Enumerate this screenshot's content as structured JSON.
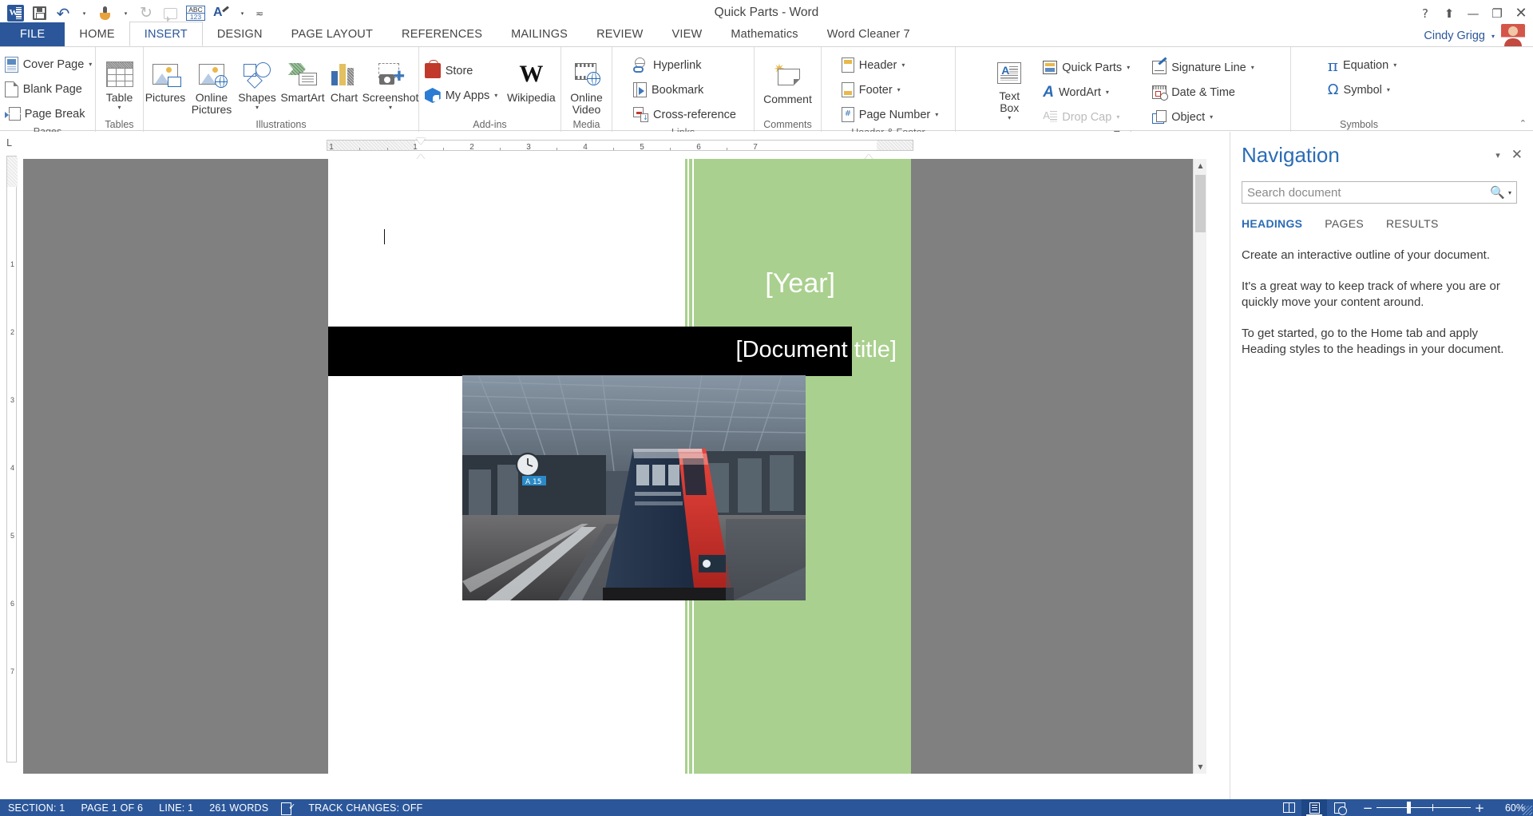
{
  "titlebar": {
    "document_title": "Quick Parts - Word",
    "qat": [
      {
        "name": "word-logo-icon",
        "label": "W"
      },
      {
        "name": "save-icon",
        "label": "Save"
      },
      {
        "name": "undo-icon",
        "label": "Undo"
      },
      {
        "name": "touch-mode-icon",
        "label": "Touch/Mouse Mode"
      },
      {
        "name": "redo-icon",
        "label": "Repeat"
      },
      {
        "name": "comment-balloon-icon",
        "label": "Comment"
      },
      {
        "name": "abc123-icon",
        "label": "ABC 123"
      },
      {
        "name": "style-painter-icon",
        "label": "Styles"
      },
      {
        "name": "customize-qat-icon",
        "label": "Customize"
      }
    ],
    "help_icon": "?",
    "ribbon_display_icon": "⬆",
    "minimize_icon": "—",
    "restore_icon": "❐",
    "close_icon": "✕"
  },
  "tabs": [
    {
      "label": "FILE",
      "active": false,
      "file": true
    },
    {
      "label": "HOME",
      "active": false
    },
    {
      "label": "INSERT",
      "active": true
    },
    {
      "label": "DESIGN",
      "active": false
    },
    {
      "label": "PAGE LAYOUT",
      "active": false
    },
    {
      "label": "REFERENCES",
      "active": false
    },
    {
      "label": "MAILINGS",
      "active": false
    },
    {
      "label": "REVIEW",
      "active": false
    },
    {
      "label": "VIEW",
      "active": false
    },
    {
      "label": "Mathematics",
      "active": false
    },
    {
      "label": "Word Cleaner 7",
      "active": false
    }
  ],
  "user": {
    "name": "Cindy Grigg",
    "caret": "▾"
  },
  "ribbon": {
    "collapse_icon": "⌃",
    "groups": {
      "pages": {
        "label": "Pages",
        "items": [
          {
            "label": "Cover Page",
            "icon": "cover-page-icon",
            "dropdown": "▾"
          },
          {
            "label": "Blank Page",
            "icon": "blank-page-icon",
            "dropdown": ""
          },
          {
            "label": "Page Break",
            "icon": "page-break-icon",
            "dropdown": ""
          }
        ]
      },
      "tables": {
        "label": "Tables",
        "button": {
          "label": "Table",
          "icon": "table-icon",
          "caret": "▾"
        }
      },
      "illustrations": {
        "label": "Illustrations",
        "buttons": [
          {
            "label": "Pictures",
            "icon": "pictures-icon",
            "caret": ""
          },
          {
            "label": "Online\nPictures",
            "icon": "online-pictures-icon",
            "caret": ""
          },
          {
            "label": "Shapes",
            "icon": "shapes-icon",
            "caret": "▾"
          },
          {
            "label": "SmartArt",
            "icon": "smartart-icon",
            "caret": ""
          },
          {
            "label": "Chart",
            "icon": "chart-icon",
            "caret": ""
          },
          {
            "label": "Screenshot",
            "icon": "screenshot-icon",
            "caret": "▾"
          }
        ]
      },
      "addins": {
        "label": "Add-ins",
        "items": [
          {
            "label": "Store",
            "icon": "store-icon",
            "dropdown": ""
          },
          {
            "label": "My Apps",
            "icon": "my-apps-icon",
            "dropdown": "▾"
          }
        ],
        "button": {
          "label": "Wikipedia",
          "icon": "wikipedia-icon",
          "caret": "▾"
        }
      },
      "media": {
        "label": "Media",
        "button": {
          "label": "Online\nVideo",
          "icon": "online-video-icon",
          "caret": ""
        }
      },
      "links": {
        "label": "Links",
        "items": [
          {
            "label": "Hyperlink",
            "icon": "hyperlink-icon",
            "dropdown": ""
          },
          {
            "label": "Bookmark",
            "icon": "bookmark-icon",
            "dropdown": ""
          },
          {
            "label": "Cross-reference",
            "icon": "cross-reference-icon",
            "dropdown": ""
          }
        ]
      },
      "comments": {
        "label": "Comments",
        "button": {
          "label": "Comment",
          "icon": "comment-icon",
          "caret": ""
        }
      },
      "header_footer": {
        "label": "Header & Footer",
        "items": [
          {
            "label": "Header",
            "icon": "header-icon",
            "dropdown": "▾"
          },
          {
            "label": "Footer",
            "icon": "footer-icon",
            "dropdown": "▾"
          },
          {
            "label": "Page Number",
            "icon": "page-number-icon",
            "dropdown": "▾"
          }
        ]
      },
      "text": {
        "label": "Text",
        "button": {
          "label": "Text\nBox",
          "icon": "text-box-icon",
          "caret": "▾"
        },
        "items": [
          {
            "label": "Quick Parts",
            "icon": "quick-parts-icon",
            "dropdown": "▾",
            "disabled": false
          },
          {
            "label": "WordArt",
            "icon": "wordart-icon",
            "dropdown": "▾",
            "disabled": false
          },
          {
            "label": "Drop Cap",
            "icon": "drop-cap-icon",
            "dropdown": "▾",
            "disabled": true
          }
        ],
        "items2": [
          {
            "label": "Signature Line",
            "icon": "signature-line-icon",
            "dropdown": "▾",
            "disabled": false
          },
          {
            "label": "Date & Time",
            "icon": "date-time-icon",
            "dropdown": "",
            "disabled": false
          },
          {
            "label": "Object",
            "icon": "object-icon",
            "dropdown": "▾",
            "disabled": false
          }
        ]
      },
      "symbols": {
        "label": "Symbols",
        "items": [
          {
            "label": "Equation",
            "icon": "equation-icon",
            "glyph": "π",
            "dropdown": "▾"
          },
          {
            "label": "Symbol",
            "icon": "symbol-icon",
            "glyph": "Ω",
            "dropdown": "▾"
          }
        ]
      }
    }
  },
  "ruler": {
    "corner_label": "L",
    "h_numbers": [
      "1",
      "1",
      "2",
      "3",
      "4",
      "5",
      "6",
      "7"
    ],
    "v_numbers": [
      "1",
      "2",
      "3",
      "4",
      "5",
      "6",
      "7"
    ]
  },
  "document": {
    "year_placeholder": "[Year]",
    "title_placeholder": "[Document title]",
    "image_alt": "train-at-station-photo"
  },
  "navigation": {
    "title": "Navigation",
    "collapse_caret": "▾",
    "close_icon": "✕",
    "search": {
      "placeholder": "Search document",
      "value": "",
      "icon": "search-icon",
      "caret": "▾"
    },
    "tabs": [
      {
        "label": "HEADINGS",
        "active": true
      },
      {
        "label": "PAGES",
        "active": false
      },
      {
        "label": "RESULTS",
        "active": false
      }
    ],
    "paragraphs": [
      "Create an interactive outline of your document.",
      "It's a great way to keep track of where you are or quickly move your content around.",
      "To get started, go to the Home tab and apply Heading styles to the headings in your document."
    ]
  },
  "statusbar": {
    "section": "SECTION: 1",
    "page": "PAGE 1 OF 6",
    "line": "LINE: 1",
    "words": "261 WORDS",
    "proofing_icon": "proofing-errors-icon",
    "track_changes": "TRACK CHANGES: OFF",
    "views": [
      {
        "name": "read-mode-icon",
        "active": false
      },
      {
        "name": "print-layout-icon",
        "active": true
      },
      {
        "name": "web-layout-icon",
        "active": false
      }
    ],
    "zoom_out": "−",
    "zoom_in": "+",
    "zoom_level": "60%"
  },
  "colors": {
    "word_blue": "#2b579a",
    "accent_blue": "#2b6cb5",
    "green_band": "#a9d08e",
    "title_band": "#000000"
  }
}
